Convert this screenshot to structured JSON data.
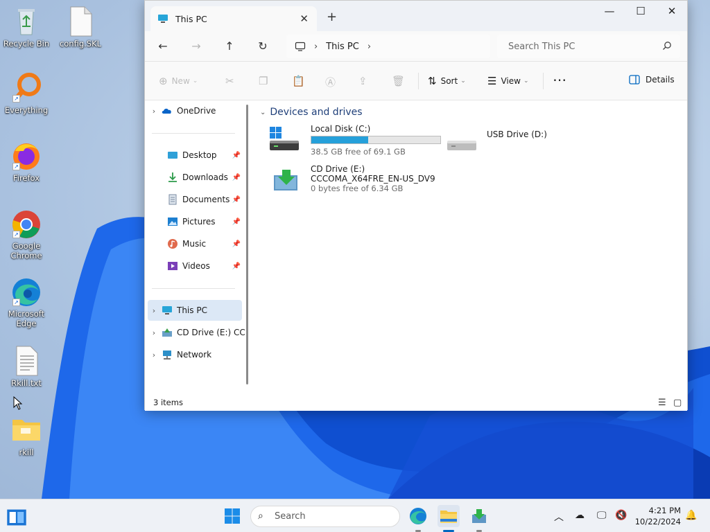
{
  "desktop": {
    "icons": [
      {
        "label": "Recycle Bin",
        "icon": "recycle-bin-icon"
      },
      {
        "label": "config.SKL",
        "icon": "file-icon"
      },
      {
        "label": "Everything",
        "icon": "everything-search-icon"
      },
      {
        "label": "Firefox",
        "icon": "firefox-icon"
      },
      {
        "label": "Google Chrome",
        "icon": "chrome-icon"
      },
      {
        "label": "Microsoft Edge",
        "icon": "edge-icon"
      },
      {
        "label": "Rkill.txt",
        "icon": "text-file-icon"
      },
      {
        "label": "rkill",
        "icon": "folder-icon"
      }
    ]
  },
  "window": {
    "tab_title": "This PC",
    "navigation": {
      "address_location": "This PC",
      "search_placeholder": "Search This PC"
    },
    "command_bar": {
      "new_label": "New",
      "sort_label": "Sort",
      "view_label": "View",
      "details_label": "Details"
    },
    "sidebar": {
      "items": [
        {
          "label": "OneDrive"
        },
        {
          "label": "Desktop"
        },
        {
          "label": "Downloads"
        },
        {
          "label": "Documents"
        },
        {
          "label": "Pictures"
        },
        {
          "label": "Music"
        },
        {
          "label": "Videos"
        },
        {
          "label": "This PC"
        },
        {
          "label": "CD Drive (E:) CC"
        },
        {
          "label": "Network"
        }
      ]
    },
    "content": {
      "group_title": "Devices and drives",
      "drives": [
        {
          "name": "Local Disk (C:)",
          "free_text": "38.5 GB free of 69.1 GB",
          "used_fraction": 0.443
        },
        {
          "name": "USB Drive (D:)"
        },
        {
          "name": "CD Drive (E:)",
          "volume_label": "CCCOMA_X64FRE_EN-US_DV9",
          "free_text": "0 bytes free of 6.34 GB"
        }
      ]
    },
    "status": {
      "item_count": "3 items"
    }
  },
  "taskbar": {
    "search_placeholder": "Search",
    "time": "4:21 PM",
    "date": "10/22/2024"
  },
  "colors": {
    "accent": "#0067c0",
    "drive_bar": "#26a0da",
    "selection": "#dce8f6"
  }
}
